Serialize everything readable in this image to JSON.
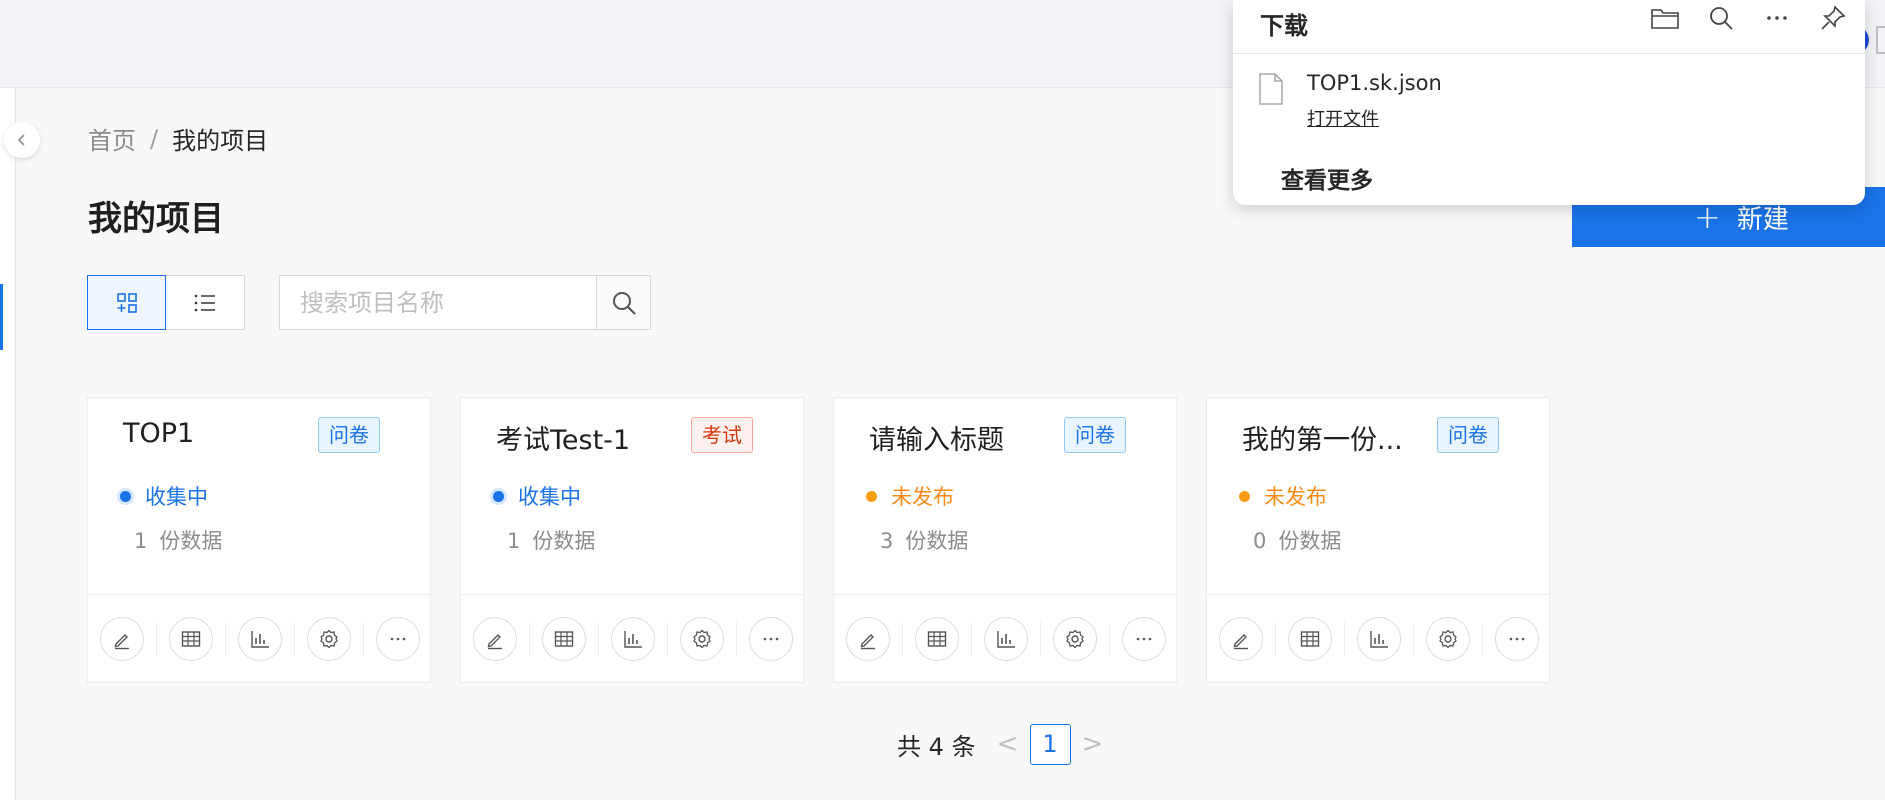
{
  "breadcrumb": {
    "home": "首页",
    "separator": "/",
    "current": "我的项目"
  },
  "page_title": "我的项目",
  "new_button": {
    "icon": "plus-icon",
    "label": "新建"
  },
  "view_toggle": {
    "grid_icon": "grid-view-icon",
    "list_icon": "list-view-icon",
    "active": "grid"
  },
  "search": {
    "placeholder": "搜索项目名称",
    "value": "",
    "icon": "search-icon"
  },
  "projects": [
    {
      "title": "TOP1",
      "tag": "问卷",
      "tag_color": "#1a73e8",
      "status": "收集中",
      "status_color": "#1a73e8",
      "count": "1",
      "count_unit": "份数据"
    },
    {
      "title": "考试Test-1",
      "tag": "考试",
      "tag_color": "#d4380d",
      "status": "收集中",
      "status_color": "#1a73e8",
      "count": "1",
      "count_unit": "份数据"
    },
    {
      "title": "请输入标题",
      "tag": "问卷",
      "tag_color": "#1a73e8",
      "status": "未发布",
      "status_color": "#fa8c16",
      "count": "3",
      "count_unit": "份数据"
    },
    {
      "title": "我的第一份...",
      "tag": "问卷",
      "tag_color": "#1a73e8",
      "status": "未发布",
      "status_color": "#fa8c16",
      "count": "0",
      "count_unit": "份数据"
    }
  ],
  "card_actions": [
    "edit-icon",
    "table-icon",
    "chart-icon",
    "settings-icon",
    "more-icon"
  ],
  "pagination": {
    "total_label": "共 4 条",
    "current_page": "1",
    "prev": "<",
    "next": ">"
  },
  "download_panel": {
    "title": "下载",
    "icons": [
      "folder-icon",
      "search-icon",
      "more-icon",
      "pin-icon"
    ],
    "file_name": "TOP1.sk.json",
    "open_file": "打开文件",
    "see_more": "查看更多"
  },
  "colors": {
    "primary": "#1a73e8",
    "warning": "#fa8c16",
    "danger": "#d4380d"
  }
}
